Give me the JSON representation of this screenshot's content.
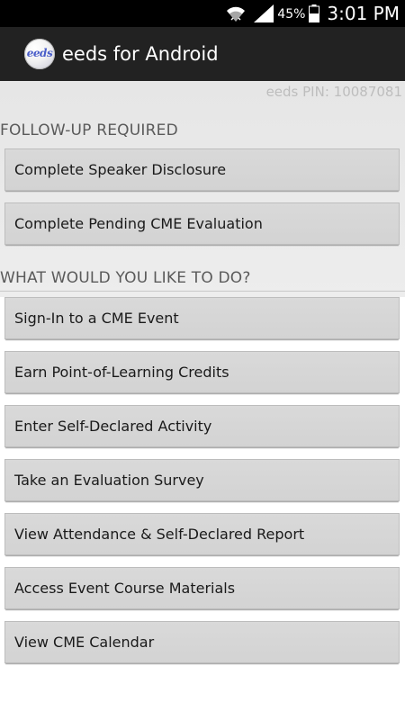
{
  "status_bar": {
    "battery_percent": "45%",
    "time": "3:01 PM",
    "icons": [
      "wifi-icon",
      "signal-icon",
      "battery-icon"
    ]
  },
  "action_bar": {
    "logo_text": "eeds",
    "title": "eeds for Android"
  },
  "pin_text": "eeds PIN: 10087081",
  "follow_up": {
    "header": "FOLLOW-UP REQUIRED",
    "items": [
      "Complete Speaker Disclosure",
      "Complete Pending CME Evaluation"
    ]
  },
  "actions": {
    "header": "WHAT WOULD YOU LIKE TO DO?",
    "items": [
      "Sign-In to a CME Event",
      "Earn Point-of-Learning Credits",
      "Enter Self-Declared Activity",
      "Take an Evaluation Survey",
      "View Attendance & Self-Declared Report",
      "Access Event Course Materials",
      "View CME Calendar"
    ]
  },
  "colors": {
    "status_bar_bg": "#000000",
    "action_bar_bg": "#222222",
    "button_bg": "#d6d6d6",
    "header_text": "#5a5a5a"
  }
}
